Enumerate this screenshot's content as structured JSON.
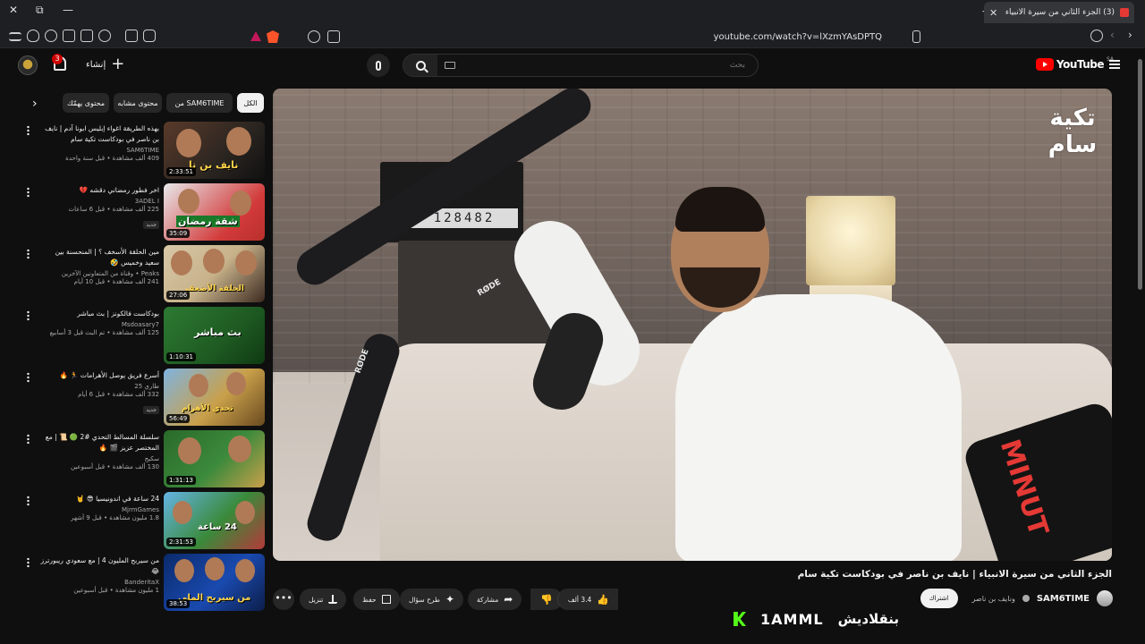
{
  "browser": {
    "tab_title": "(3) الجزء الثاني من سيرة الانبياء | نايف",
    "url": "youtube.com/watch?v=lXzmYAsDPTQ"
  },
  "header": {
    "notification_count": "3",
    "create_label": "إنشاء",
    "search_placeholder": "بحث",
    "logo_text": "YouTube",
    "region": "SA"
  },
  "chips": [
    "الكل",
    "من SAM6TIME",
    "محتوى مشابه",
    "محتوى يهمّك"
  ],
  "recommendations": [
    {
      "title": "بهذه الطريقة اغواء إبليس ابونا آدم | نايف بن ناصر في بودكاست تكية سام",
      "channel": "SAM6TIME",
      "views": "409 ألف مشاهدة • قبل سنة واحدة",
      "duration": "2:33:51",
      "badge": "",
      "thumb_text": "نايف بن نا"
    },
    {
      "title": "اخر فطور رمضاني دقشه 💔",
      "channel": "3ADEL I",
      "views": "225 ألف مشاهدة • قبل 6 ساعات",
      "duration": "35:09",
      "badge": "جديد",
      "thumb_text": "شقة رمضان"
    },
    {
      "title": "مين الحلقة الأسخف ؟ | المنحسنة بين سعيد وخميس 🤣",
      "channel": "Peaks • وقناة من المتعاونين الآخرين",
      "views": "241 ألف مشاهدة • قبل 10 أيام",
      "duration": "27:06",
      "badge": "",
      "thumb_text": "الحلقة الأضعف"
    },
    {
      "title": "بودكاست فالكونز | بث مباشر",
      "channel": "Msdoasary7",
      "views": "125 ألف مشاهدة • تم البث قبل 3 أسابيع",
      "duration": "1:10:31",
      "badge": "",
      "thumb_text": "بث مباشر"
    },
    {
      "title": "أسرع فريق يوصل الأهرامات 🏃 🔥",
      "channel": "طاري 25",
      "views": "332 ألف مشاهدة • قبل 6 أيام",
      "duration": "56:49",
      "badge": "جديد",
      "thumb_text": "تحدي الأهرام"
    },
    {
      "title": "سلسلة المسالط التحدي #2 🟢 📜 | مع المختصر عزيز 🎬 🔥",
      "channel": "سكيج",
      "views": "130 ألف مشاهدة • قبل أسبوعين",
      "duration": "1:31:13",
      "badge": "",
      "thumb_text": ""
    },
    {
      "title": "24 ساعة في اندونيسيا 😎 🤘",
      "channel": "MjrmGames",
      "views": "1.8 مليون مشاهدة • قبل 9 أشهر",
      "duration": "2:31:53",
      "badge": "",
      "thumb_text": "24 ساعة"
    },
    {
      "title": "من سيربح المليون 4 | مع سعودي ريبورترز 😂",
      "channel": "BanderitaX",
      "views": "1 مليون مشاهدة • قبل أسبوعين",
      "duration": "38:53",
      "badge": "",
      "thumb_text": "من سيربح الملي"
    }
  ],
  "player": {
    "watermark": "تكية سام",
    "clapper_digits": "128482",
    "mic_brand": "RØDE",
    "pillow_text": "MINUT"
  },
  "video": {
    "title": "الجزء الثاني من سيرة الانبياء | نايف بن ناصر في بودكاست تكية سام",
    "channel": "SAM6TIME",
    "collab": "ونايف بن ناصر",
    "subscribe_label": "اشتراك",
    "likes": "3.4 ألف",
    "share_label": "مشاركة",
    "ask_label": "طرح سؤال",
    "save_label": "حفظ",
    "download_label": "تنزيل",
    "more_label": "•••"
  },
  "overlay": {
    "code": "1AMML",
    "text": "بنقلاديش"
  }
}
